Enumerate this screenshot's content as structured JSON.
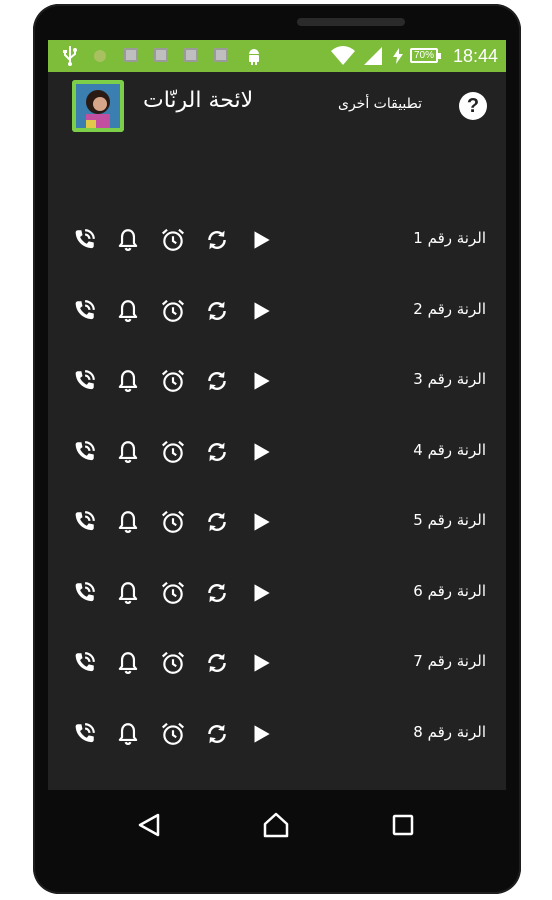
{
  "status_bar": {
    "time": "18:44",
    "battery": "70%",
    "background_color": "#7dbd3a",
    "icons": [
      "usb-icon",
      "notification-icon",
      "notification-icon",
      "notification-icon",
      "notification-icon",
      "android-icon",
      "wifi-icon",
      "signal-icon",
      "charging-icon"
    ]
  },
  "app_bar": {
    "title": "لائحة الرنّات",
    "other_apps_label": "تطبيقات أخرى",
    "help_symbol": "?"
  },
  "ringtones": [
    {
      "label": "الرنة رقم 1"
    },
    {
      "label": "الرنة رقم 2"
    },
    {
      "label": "الرنة رقم 3"
    },
    {
      "label": "الرنة رقم 4"
    },
    {
      "label": "الرنة رقم 5"
    },
    {
      "label": "الرنة رقم 6"
    },
    {
      "label": "الرنة رقم 7"
    },
    {
      "label": "الرنة رقم 8"
    }
  ],
  "row_actions": [
    "set-contact-ringtone-icon",
    "notification-bell-icon",
    "alarm-clock-icon",
    "repeat-icon",
    "play-icon"
  ],
  "nav_bar": [
    "back-icon",
    "home-icon",
    "recents-icon"
  ]
}
